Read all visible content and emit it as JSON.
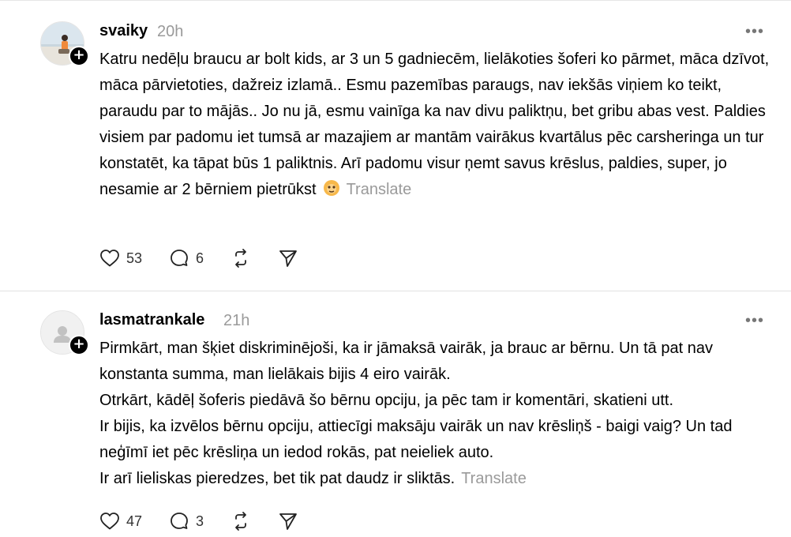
{
  "posts": [
    {
      "username": "svaiky",
      "time": "20h",
      "text": "Katru nedēļu braucu ar bolt kids, ar 3 un 5 gadniecēm, lielākoties šoferi ko pārmet, māca dzīvot, māca pārvietoties, dažreiz izlamā.. Esmu pazemības paraugs, nav iekšās viņiem ko teikt, paraudu par to mājās.. Jo nu jā, esmu vainīga ka nav divu paliktņu, bet gribu abas vest. Paldies visiem par padomu iet tumsā ar mazajiem ar mantām vairākus kvartālus pēc carsheringa un tur konstatēt, ka tāpat būs 1 paliktnis. Arī padomu visur ņemt savus krēslus, paldies, super, jo nesamie ar 2 bērniem pietrūkst",
      "translate": "Translate",
      "likes": "53",
      "replies": "6",
      "avatar_icon": "profile-photo",
      "emoji_icon": "face-emoji-icon"
    },
    {
      "username": "lasmatrankale",
      "time": "21h",
      "text_lines": [
        "Pirmkārt, man šķiet diskriminējoši, ka ir jāmaksā vairāk, ja brauc ar bērnu. Un tā pat nav konstanta summa, man lielākais bijis 4 eiro vairāk.",
        "Otrkārt, kādēļ šoferis piedāvā šo bērnu opciju, ja pēc tam ir komentāri, skatieni utt.",
        "Ir bijis, ka izvēlos bērnu opciju, attiecīgi maksāju vairāk un nav krēsliņš - baigi vaig? Un tad neģīmī iet pēc krēsliņa un iedod rokās, pat neieliek auto.",
        "Ir arī lieliskas pieredzes, bet tik pat daudz ir sliktās."
      ],
      "translate": "Translate",
      "likes": "47",
      "replies": "3",
      "avatar_icon": "default-avatar"
    }
  ],
  "more_label": "•••",
  "follow_label": "+",
  "colors": {
    "muted": "#9a9a9a",
    "text": "#000000",
    "divider": "#e2e2e2"
  }
}
